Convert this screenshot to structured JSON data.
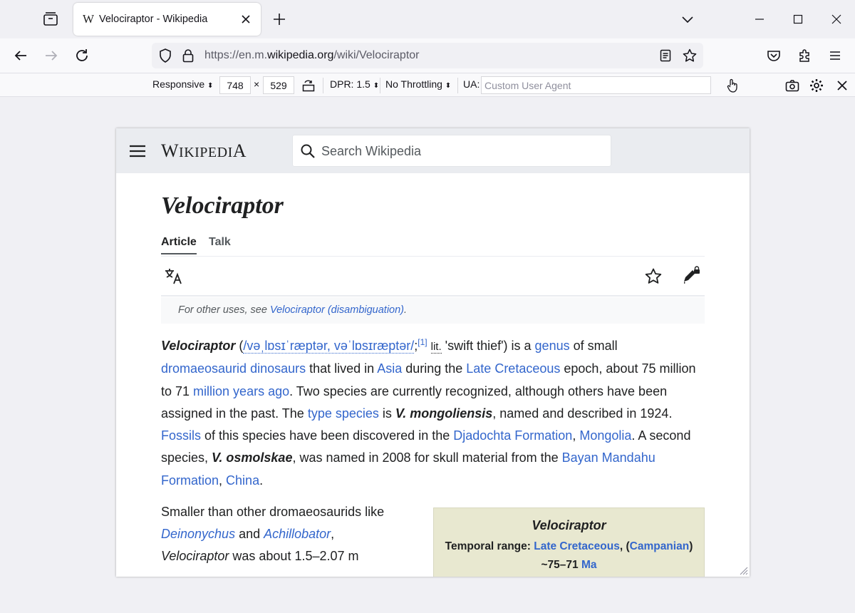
{
  "browser": {
    "tab": {
      "favicon": "W",
      "title": "Velociraptor - Wikipedia"
    },
    "url": {
      "prefix": "https://en.m.",
      "host": "wikipedia.org",
      "path": "/wiki/Velociraptor"
    }
  },
  "rdm": {
    "device": "Responsive",
    "width": "748",
    "times": "×",
    "height": "529",
    "dpr": "DPR: 1.5",
    "throttling": "No Throttling",
    "ua_label": "UA:",
    "ua_placeholder": "Custom User Agent"
  },
  "wiki": {
    "logo_w": "W",
    "logo_rest": "IKIPEDI",
    "logo_a": "A",
    "search_placeholder": "Search Wikipedia",
    "title": "Velociraptor",
    "tabs": [
      "Article",
      "Talk"
    ],
    "hatnote_prefix": "For other uses, see ",
    "hatnote_link": "Velociraptor (disambiguation)",
    "hatnote_suffix": ".",
    "lead": {
      "name": "Velociraptor",
      "paren_open": " (",
      "ipa": "/vəˌlɒsɪˈræptər, vəˈlɒsɪræptər/",
      "semicolon": ";",
      "ref": "[1]",
      "lit": "lit.",
      "t1": " 'swift thief') is a ",
      "genus": "genus",
      "t2": " of small ",
      "dromaeosaurid": "dromaeosaurid dinosaurs",
      "t3": " that lived in ",
      "asia": "Asia",
      "t4": " during the ",
      "late_cretaceous": "Late Cretaceous",
      "t5": " epoch, about 75 million to 71 ",
      "mya": "million years ago",
      "t6": ". Two species are currently recognized, although others have been assigned in the past. The ",
      "type_species": "type species",
      "t7": " is ",
      "mongoliensis": "V. mongoliensis",
      "t8": ", named and described in 1924. ",
      "fossils": "Fossils",
      "t9": " of this species have been discovered in the ",
      "djadochta": "Djadochta Formation",
      "comma": ", ",
      "mongolia": "Mongolia",
      "t10": ". A second species, ",
      "osmolskae": "V. osmolskae",
      "t11": ", was named in 2008 for skull material from the ",
      "bayan": "Bayan Mandahu Formation",
      "comma2": ", ",
      "china": "China",
      "t12": "."
    },
    "second": {
      "t1": "Smaller than other dromaeosaurids like ",
      "deinonychus": "Deinonychus",
      "and": " and ",
      "achillobator": "Achillobator",
      "comma": ",",
      "name": "Velociraptor",
      "t2": " was about 1.5–2.07 m"
    },
    "infobox": {
      "title": "Velociraptor",
      "range_label": "Temporal range: ",
      "range_link": "Late Cretaceous",
      "range_mid": ", (",
      "campanian": "Campanian",
      "range_close": ")",
      "ma_prefix": "~75–71 ",
      "ma": "Ma"
    }
  },
  "colors": {
    "link": "#3366cc",
    "header_bg": "#eaecf0",
    "infobox_bg": "#e8e8d0"
  }
}
